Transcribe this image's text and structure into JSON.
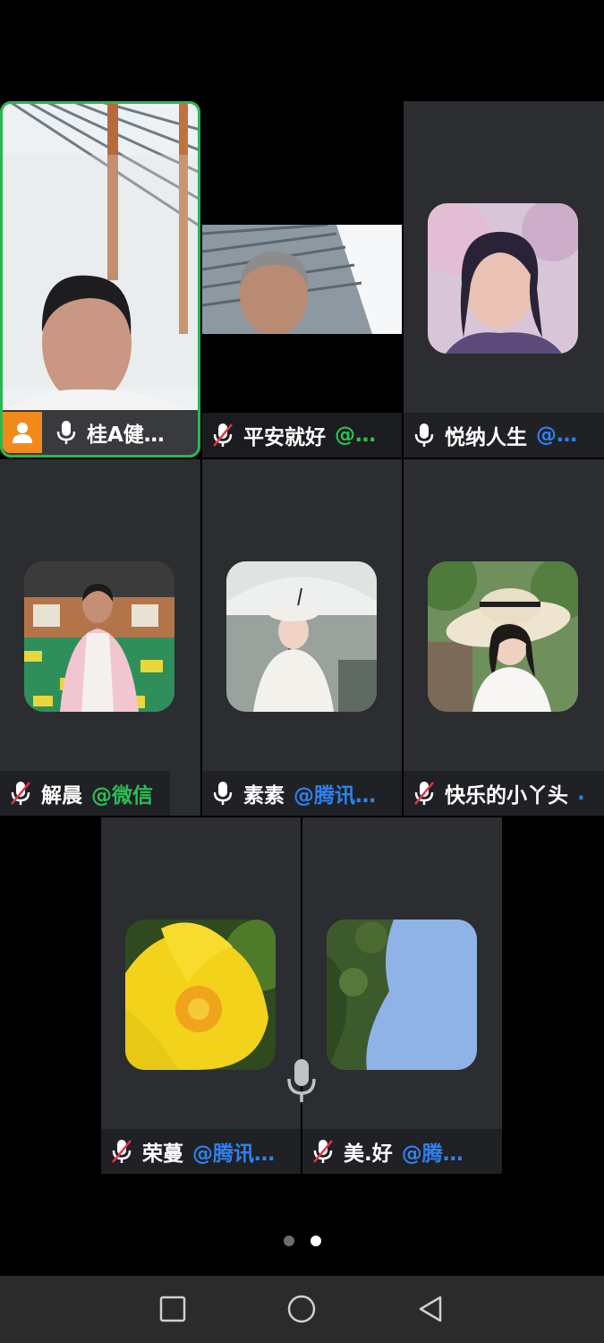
{
  "participants": [
    {
      "name": "桂A健…",
      "source": "",
      "muted": false,
      "host": true,
      "speaking": true
    },
    {
      "name": "平安就好",
      "source": "@…",
      "source_color": "green",
      "muted": true
    },
    {
      "name": "悦纳人生",
      "source": "@…",
      "source_color": "blue",
      "muted": false
    },
    {
      "name": "解晨",
      "source": "@微信",
      "source_color": "green",
      "muted": true
    },
    {
      "name": "素素",
      "source": "@腾讯…",
      "source_color": "blue",
      "muted": false
    },
    {
      "name": "快乐的小丫头",
      "source": ".",
      "source_color": "blue",
      "muted": true
    },
    {
      "name": "荣蔓",
      "source": "@腾讯…",
      "source_color": "blue",
      "muted": true
    },
    {
      "name": "美.好",
      "source": "@腾…",
      "source_color": "blue",
      "muted": true
    }
  ],
  "pagination": {
    "pages": 2,
    "current": 2
  },
  "colors": {
    "speaking_border": "#27b950",
    "host_badge": "#f28a1b",
    "wechat_green": "#2cbf55",
    "tencent_blue": "#2f80ed"
  },
  "icons": {
    "mic": "mic-icon",
    "mic_muted": "mic-muted-icon",
    "host": "host-person-icon",
    "floating_mic": "floating-mic-icon"
  },
  "nav": [
    "recent-apps-button",
    "home-button",
    "back-button"
  ]
}
